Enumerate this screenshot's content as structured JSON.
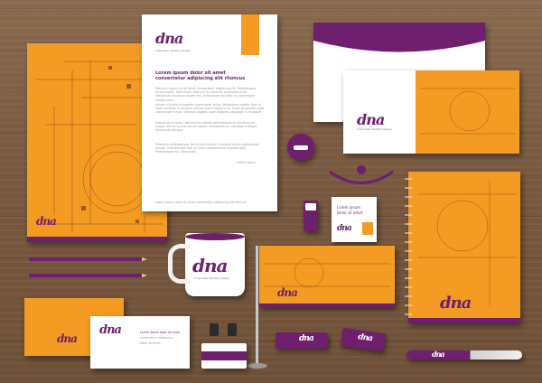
{
  "brand": {
    "logo_text": "dna",
    "tagline": "Corporate Identity Design",
    "colors": {
      "orange": "#f39b22",
      "purple": "#6e1f6e",
      "wood": "#7a5a40"
    }
  },
  "letterhead": {
    "heading_line1": "Lorem ipsum dolor sit amet",
    "heading_line2": "consectetur adipiscing elit rhoncus",
    "para1": "Mauris in ligula nisl sit amet, consectetur adipiscing elit. Pellentesque turpis sapien, sollicitudin vitae dui id, tincidunt consequat justo. Vestibulum tincidunt sapien nisi, id tincidunt vel dolor at, scelerisque dictum nunc.",
    "para2": "Mauris in luctus ut sodales ullamcorper tellus. Vestibulum sagittis Quis id amet volutpat. In id ligula ultrices quis fringilla urna. Vivamus egestas eget ullamcorper turpis. Vivamus sagittis quam lobortis vulputate, in id sapien.",
    "para3": "Nullam lacus tortor, elementum aliquet pellentesque ut, tincidunt eu augue. Sed ac cursus dui vel sapien. Vestibulum ac vulputate tristique. Sollicitudin congue.",
    "para4": "Phasellus pellentesque. Morbi arcu dictum, id aliquet purus ullamcorper aliquet. Praesent sed felis eu nulla condimentum aliquam quis. Pellentesque dui. Maecenas.",
    "signature": "Lorem ipsum",
    "footer": "Lorem ipsum dolor sit amet consectetur adipiscing elit rhoncus"
  },
  "id_badge": {
    "line1": "Lorem ipsum",
    "line2": "Dolor sit amet"
  },
  "business_card": {
    "line1": "Lorem ipsum dolor sit amet",
    "line2": "consectetur adipiscing",
    "line3": "Dolor sit amet"
  }
}
